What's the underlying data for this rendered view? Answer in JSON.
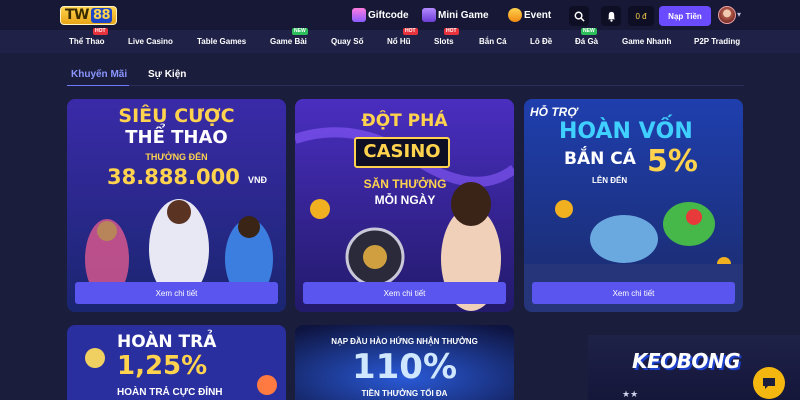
{
  "header": {
    "logo_text": "TW",
    "logo_num": "88",
    "giftcode": "Giftcode",
    "mini_game": "Mini Game",
    "event": "Event",
    "balance": "0 đ",
    "deposit": "Nạp Tiền"
  },
  "nav": {
    "items": [
      {
        "label": "Thể Thao",
        "badge": "HOT"
      },
      {
        "label": "Live Casino",
        "badge": ""
      },
      {
        "label": "Table Games",
        "badge": ""
      },
      {
        "label": "Game Bài",
        "badge": "NEW"
      },
      {
        "label": "Quay Số",
        "badge": ""
      },
      {
        "label": "Nổ Hũ",
        "badge": "HOT"
      },
      {
        "label": "Slots",
        "badge": "HOT"
      },
      {
        "label": "Bắn Cá",
        "badge": ""
      },
      {
        "label": "Lô Đề",
        "badge": ""
      },
      {
        "label": "Đá Gà",
        "badge": "NEW"
      },
      {
        "label": "Game Nhanh",
        "badge": ""
      },
      {
        "label": "P2P Trading",
        "badge": ""
      }
    ]
  },
  "tabs": [
    "Khuyến Mãi",
    "Sự Kiện"
  ],
  "cards": [
    {
      "line1": "SIÊU CƯỢC",
      "line2": "THỂ THAO",
      "line3": "THƯỞNG ĐẾN",
      "line4": "38.888.000",
      "line5": "VNĐ",
      "button": "Xem chi tiết"
    },
    {
      "line1": "ĐỘT PHÁ",
      "line2": "CASINO",
      "line3": "SĂN THƯỞNG",
      "line4": "MỖI NGÀY",
      "button": "Xem chi tiết"
    },
    {
      "line1": "HỖ TRỢ",
      "line2": "HOÀN VỐN",
      "line3": "BẮN CÁ",
      "line4": "5%",
      "line5": "LÊN ĐẾN",
      "button": "Xem chi tiết"
    },
    {
      "line1": "HOÀN TRẢ",
      "line2": "1,25%",
      "line3": "HOÀN TRẢ CỰC ĐỈNH"
    },
    {
      "line1": "NẠP ĐẦU HÀO HỨNG NHẬN THƯỞNG",
      "line2": "110%",
      "line3": "TIỀN THƯỞNG TỐI ĐA"
    }
  ],
  "watermark": "KEOBONG",
  "colors": {
    "accent": "#6a4bff",
    "button": "#5a55ee",
    "tab_active": "#8a95ff",
    "gold": "#ffd34d"
  }
}
